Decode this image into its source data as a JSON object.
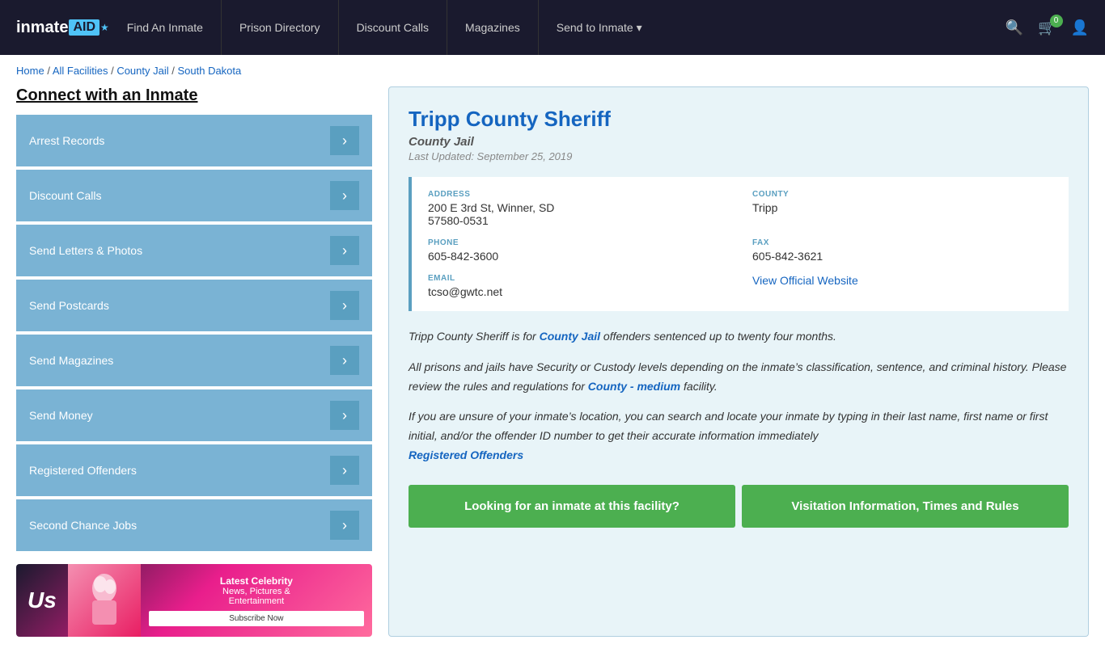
{
  "nav": {
    "logo": "inmate",
    "logo_aid": "AID",
    "links": [
      {
        "label": "Find An Inmate",
        "id": "find-inmate"
      },
      {
        "label": "Prison Directory",
        "id": "prison-directory"
      },
      {
        "label": "Discount Calls",
        "id": "discount-calls"
      },
      {
        "label": "Magazines",
        "id": "magazines"
      },
      {
        "label": "Send to Inmate ▾",
        "id": "send-to-inmate"
      }
    ],
    "cart_count": "0",
    "search_label": "Search"
  },
  "breadcrumb": {
    "home": "Home",
    "separator": "/",
    "all_facilities": "All Facilities",
    "county_jail": "County Jail",
    "state": "South Dakota"
  },
  "sidebar": {
    "title": "Connect with an Inmate",
    "buttons": [
      "Arrest Records",
      "Discount Calls",
      "Send Letters & Photos",
      "Send Postcards",
      "Send Magazines",
      "Send Money",
      "Registered Offenders",
      "Second Chance Jobs"
    ],
    "ad": {
      "logo": "Us",
      "headline": "Latest Celebrity",
      "sub1": "News, Pictures &",
      "sub2": "Entertainment",
      "subscribe": "Subscribe Now"
    }
  },
  "facility": {
    "title": "Tripp County Sheriff",
    "type": "County Jail",
    "last_updated": "Last Updated: September 25, 2019",
    "address_label": "ADDRESS",
    "address_line1": "200 E 3rd St, Winner, SD",
    "address_line2": "57580-0531",
    "county_label": "COUNTY",
    "county_value": "Tripp",
    "phone_label": "PHONE",
    "phone_value": "605-842-3600",
    "fax_label": "FAX",
    "fax_value": "605-842-3621",
    "email_label": "EMAIL",
    "email_value": "tcso@gwtc.net",
    "website_label": "View Official Website",
    "website_url": "#",
    "desc1": "Tripp County Sheriff is for ",
    "desc1_bold": "County Jail",
    "desc1_end": " offenders sentenced up to twenty four months.",
    "desc2": "All prisons and jails have Security or Custody levels depending on the inmate’s classification, sentence, and criminal history. Please review the rules and regulations for ",
    "desc2_link": "County - medium",
    "desc2_end": " facility.",
    "desc3": "If you are unsure of your inmate’s location, you can search and locate your inmate by typing in their last name, first name or first initial, and/or the offender ID number to get their accurate information immediately",
    "desc3_link": "Registered Offenders",
    "cta1": "Looking for an inmate at this facility?",
    "cta2": "Visitation Information, Times and Rules"
  }
}
